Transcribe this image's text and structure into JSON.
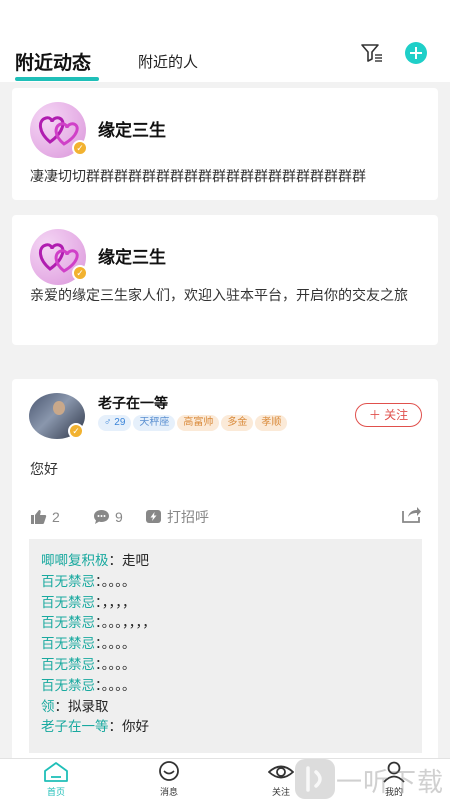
{
  "header": {
    "tab_active": "附近动态",
    "tab_other": "附近的人",
    "filter_icon": "filter-icon",
    "add_icon": "add-circle-icon",
    "accent": "#1fbfb8"
  },
  "cards": [
    {
      "name": "缘定三生",
      "text": "凄凄切切群群群群群群群群群群群群群群群群群群群群"
    },
    {
      "name": "缘定三生",
      "text": "亲爱的缘定三生家人们，欢迎入驻本平台，开启你的交友之旅"
    }
  ],
  "post": {
    "name": "老子在一等",
    "gender_icon": "male-icon",
    "age": "29",
    "tags": [
      "天秤座",
      "高富帅",
      "多金",
      "孝顺"
    ],
    "follow_label": "关注",
    "content": "您好",
    "likes": "2",
    "comments_count": "9",
    "greet_label": "打招呼",
    "comments": [
      {
        "user": "唧唧复积极",
        "text": "走吧"
      },
      {
        "user": "百无禁忌",
        "text": "。。。。"
      },
      {
        "user": "百无禁忌",
        "text": "，，，，"
      },
      {
        "user": "百无禁忌",
        "text": "。。。，，，，"
      },
      {
        "user": "百无禁忌",
        "text": "。。。。"
      },
      {
        "user": "百无禁忌",
        "text": "。。。。"
      },
      {
        "user": "百无禁忌",
        "text": "。。。。"
      },
      {
        "user": "领",
        "text": "拟录取"
      },
      {
        "user": "老子在一等",
        "text": "你好"
      }
    ]
  },
  "nav": {
    "home": "首页",
    "messages": "消息",
    "follow": "关注",
    "mine": "我的"
  },
  "watermark": "一听下载"
}
